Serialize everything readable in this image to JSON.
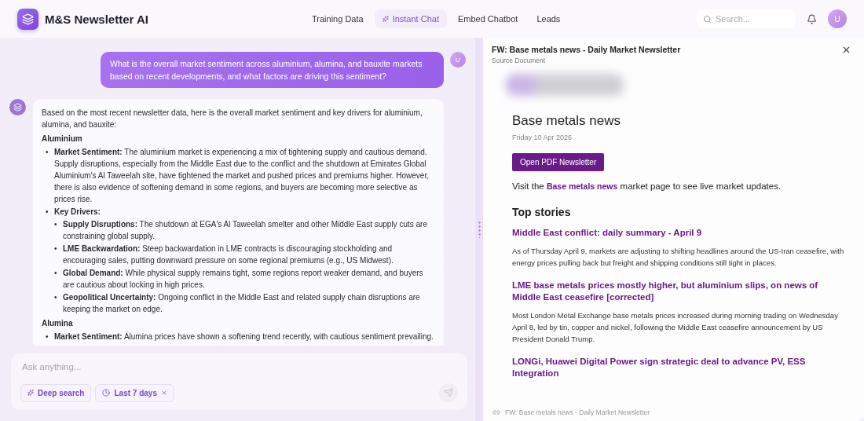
{
  "header": {
    "app_name": "M&S Newsletter AI",
    "nav": [
      {
        "label": "Training Data",
        "selected": false,
        "kind": "plain"
      },
      {
        "label": "Instant Chat",
        "selected": true,
        "kind": "sparkle"
      },
      {
        "label": "Embed Chatbot",
        "selected": false,
        "kind": "plain"
      },
      {
        "label": "Leads",
        "selected": false,
        "kind": "plain"
      }
    ],
    "search": {
      "placeholder": "Search..."
    },
    "avatar": "U"
  },
  "chat": {
    "user_message": {
      "text": "What is the overall market sentiment across aluminium, alumina, and bauxite markets based on recent developments, and what factors are driving this sentiment?",
      "avatar": "U"
    },
    "assistant_message": {
      "intro": "Based on the most recent newsletter data, here is the overall market sentiment and key drivers for aluminium, alumina, and bauxite:",
      "sections": [
        {
          "heading": "Aluminium",
          "items": [
            {
              "marker": "•",
              "label": "Market Sentiment:",
              "text": "The aluminium market is experiencing a mix of tightening supply and cautious demand. Supply disruptions, especially from the Middle East due to the conflict and the shutdown at Emirates Global Aluminium's Al Taweelah site, have tightened the market and pushed prices and premiums higher. However, there is also evidence of softening demand in some regions, and buyers are becoming more selective as prices rise."
            },
            {
              "marker": "•",
              "label": "Key Drivers:",
              "children": [
                {
                  "marker": "•",
                  "label": "Supply Disruptions:",
                  "text": "The shutdown at EGA's Al Taweelah smelter and other Middle East supply cuts are constraining global supply."
                },
                {
                  "marker": "•",
                  "label": "LME Backwardation:",
                  "text": "Steep backwardation in LME contracts is discouraging stockholding and encouraging sales, putting downward pressure on some regional premiums (e.g., US Midwest)."
                },
                {
                  "marker": "•",
                  "label": "Global Demand:",
                  "text": "While physical supply remains tight, some regions report weaker demand, and buyers are cautious about locking in high prices."
                },
                {
                  "marker": "•",
                  "label": "Geopolitical Uncertainty:",
                  "text": "Ongoing conflict in the Middle East and related supply chain disruptions are keeping the market on edge."
                }
              ]
            }
          ]
        },
        {
          "heading": "Alumina",
          "items": [
            {
              "marker": "•",
              "label": "Market Sentiment:",
              "text": "Alumina prices have shown a softening trend recently, with cautious sentiment prevailing."
            }
          ]
        }
      ]
    },
    "composer": {
      "placeholder": "Ask anything...",
      "chips": [
        {
          "label": "Deep search",
          "kind": "sparkle",
          "removable": false
        },
        {
          "label": "Last 7 days",
          "kind": "clock",
          "removable": true
        }
      ]
    }
  },
  "document": {
    "title": "FW: Base metals news - Daily Market Newsletter",
    "subtitle": "Source Document",
    "heading": "Base metals news",
    "date": "Friday 10 Apr 2026",
    "button": "Open PDF Newsletter",
    "visit": "Visit the **Base metals news** market page to see live market updates.",
    "top_stories_heading": "Top stories",
    "stories": [
      {
        "title": "Middle East conflict: daily summary - April 9",
        "summary": "As of Thursday April 9, markets are adjusting to shifting headlines around the US-Iran ceasefire, with energy prices pulling back but freight and shipping conditions still tight in places."
      },
      {
        "title": "LME base metals prices mostly higher, but aluminium slips, on news of Middle East ceasefire [corrected]",
        "summary": "Most London Metal Exchange base metals prices increased during morning trading on Wednesday April 8, led by tin, copper and nickel, following the Middle East ceasefire announcement by US President Donald Trump."
      },
      {
        "title": "LONGi, Huawei Digital Power sign strategic deal to advance PV, ESS Integration"
      }
    ],
    "footer": "FW: Base metals news - Daily Market Newsletter"
  }
}
